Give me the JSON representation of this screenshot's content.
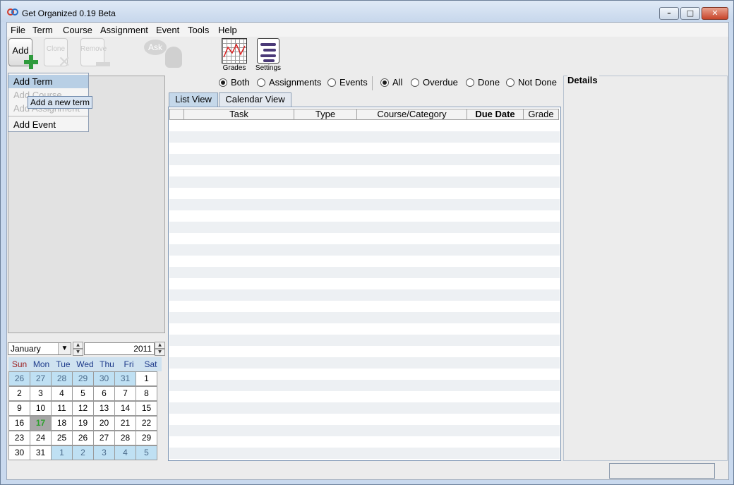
{
  "window": {
    "title": "Get Organized 0.19 Beta"
  },
  "menu": [
    "File",
    "Term",
    "Course",
    "Assignment",
    "Event",
    "Tools",
    "Help"
  ],
  "toolbar": {
    "add_label": "Add",
    "clone_label": "Clone",
    "remove_label": "Remove",
    "ask_label": "Ask",
    "grades_label": "Grades",
    "settings_label": "Settings"
  },
  "add_menu": {
    "items": [
      {
        "label": "Add Term",
        "state": "highlighted"
      },
      {
        "label": "Add Course",
        "state": "disabled"
      },
      {
        "label": "Add Assignment",
        "state": "disabled"
      },
      {
        "label": "Add Event",
        "state": "enabled"
      }
    ],
    "tooltip": "Add a new term"
  },
  "calendar": {
    "month": "January",
    "year": "2011",
    "weekdays": [
      "Sun",
      "Mon",
      "Tue",
      "Wed",
      "Thu",
      "Fri",
      "Sat"
    ],
    "today": "17",
    "weeks": [
      [
        "26",
        "27",
        "28",
        "29",
        "30",
        "31",
        "1"
      ],
      [
        "2",
        "3",
        "4",
        "5",
        "6",
        "7",
        "8"
      ],
      [
        "9",
        "10",
        "11",
        "12",
        "13",
        "14",
        "15"
      ],
      [
        "16",
        "17",
        "18",
        "19",
        "20",
        "21",
        "22"
      ],
      [
        "23",
        "24",
        "25",
        "26",
        "27",
        "28",
        "29"
      ],
      [
        "30",
        "31",
        "1",
        "2",
        "3",
        "4",
        "5"
      ]
    ]
  },
  "filters": {
    "type_options": [
      {
        "label": "Both",
        "selected": true
      },
      {
        "label": "Assignments",
        "selected": false
      },
      {
        "label": "Events",
        "selected": false
      }
    ],
    "status_options": [
      {
        "label": "All",
        "selected": true
      },
      {
        "label": "Overdue",
        "selected": false
      },
      {
        "label": "Done",
        "selected": false
      },
      {
        "label": "Not Done",
        "selected": false
      }
    ]
  },
  "tabs": [
    {
      "label": "List View",
      "active": true
    },
    {
      "label": "Calendar View",
      "active": false
    }
  ],
  "table": {
    "columns": [
      "",
      "Task",
      "Type",
      "Course/Category",
      "Due Date",
      "Grade"
    ],
    "sorted_column": "Due Date",
    "rows": []
  },
  "details": {
    "title": "Details"
  },
  "colors": {
    "accent": "#c5d8ea",
    "today_text": "#2ea02e",
    "other_month_bg": "#bfe0f3",
    "add_plus": "#2e9a3c"
  }
}
